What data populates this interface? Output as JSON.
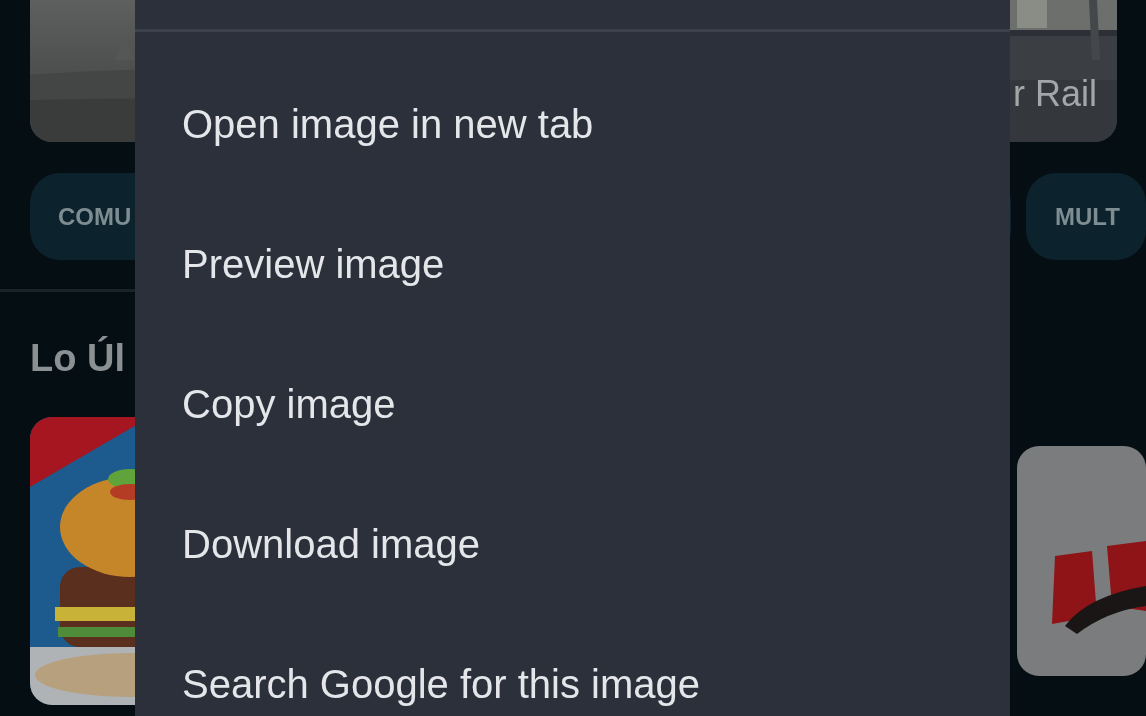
{
  "background": {
    "featured_caption": "r Rail",
    "category_chips": [
      {
        "label": "COMU"
      },
      {
        "label": "MULT"
      }
    ],
    "section_title": "Lo Úl"
  },
  "context_menu": {
    "items": [
      {
        "label": "Open image in new tab"
      },
      {
        "label": "Preview image"
      },
      {
        "label": "Copy image"
      },
      {
        "label": "Download image"
      },
      {
        "label": "Search Google for this image"
      }
    ]
  }
}
